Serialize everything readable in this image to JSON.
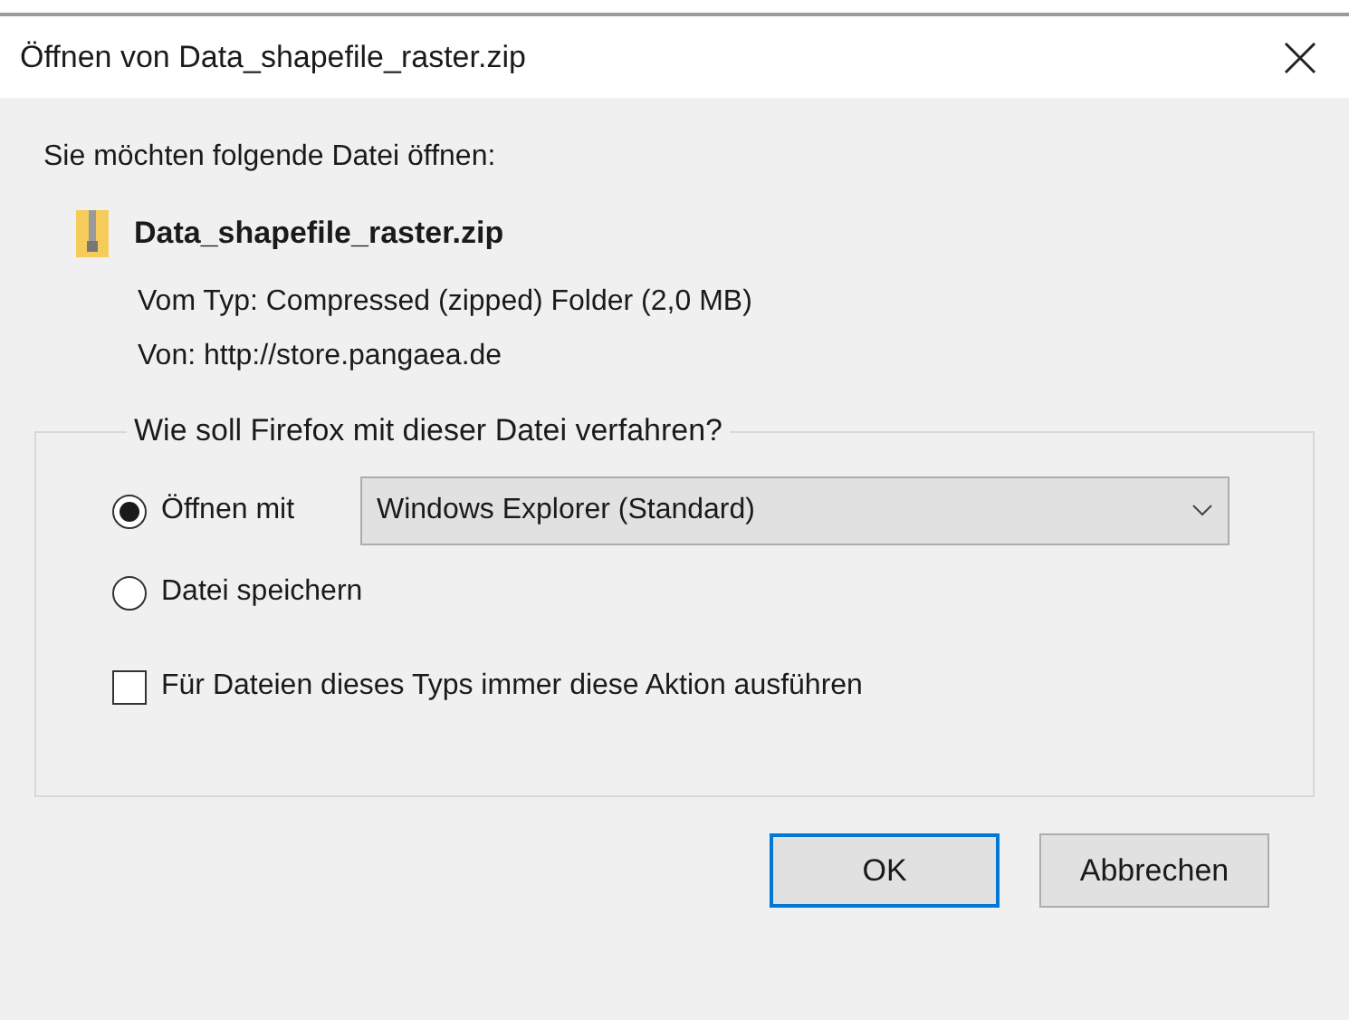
{
  "window": {
    "title": "Öffnen von Data_shapefile_raster.zip"
  },
  "intro": "Sie möchten folgende Datei öffnen:",
  "file": {
    "name": "Data_shapefile_raster.zip",
    "type_label": "Vom Typ:",
    "type_value": "Compressed (zipped) Folder (2,0 MB)",
    "from_label": "Von:",
    "from_value": "http://store.pangaea.de"
  },
  "group": {
    "legend": "Wie soll Firefox mit dieser Datei verfahren?",
    "options": [
      {
        "label": "Öffnen mit",
        "selected": true,
        "kind": "open"
      },
      {
        "label": "Datei speichern",
        "selected": false,
        "kind": "save"
      }
    ],
    "app_select": {
      "value": "Windows Explorer (Standard)"
    },
    "always": {
      "label": "Für Dateien dieses Typs immer diese Aktion ausführen",
      "checked": false
    }
  },
  "buttons": [
    {
      "label": "OK",
      "default": true
    },
    {
      "label": "Abbrechen",
      "default": false
    }
  ]
}
